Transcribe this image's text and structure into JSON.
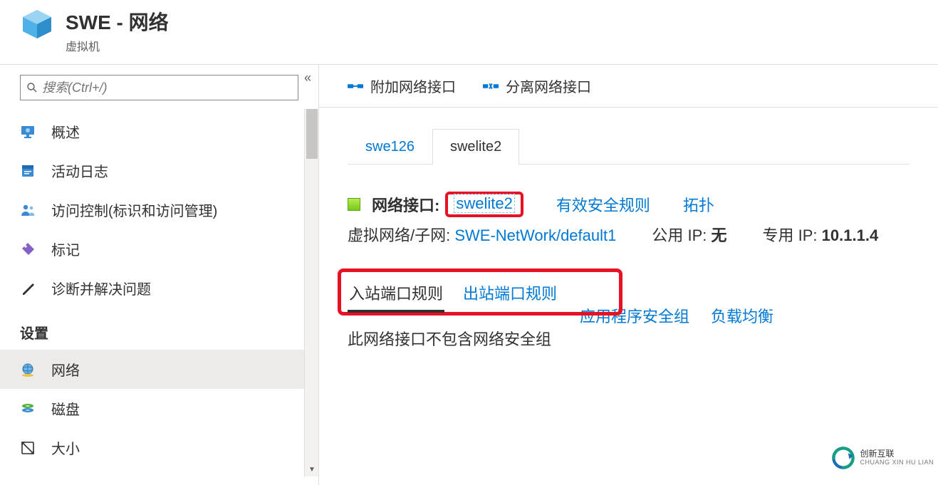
{
  "header": {
    "title": "SWE - 网络",
    "subtitle": "虚拟机"
  },
  "sidebar": {
    "search_placeholder": "搜索(Ctrl+/)",
    "menu_top": [
      {
        "key": "overview",
        "label": "概述"
      },
      {
        "key": "activity-log",
        "label": "活动日志"
      },
      {
        "key": "access-control",
        "label": "访问控制(标识和访问管理)"
      },
      {
        "key": "tags",
        "label": "标记"
      },
      {
        "key": "diagnose",
        "label": "诊断并解决问题"
      }
    ],
    "settings_heading": "设置",
    "menu_settings": [
      {
        "key": "networking",
        "label": "网络",
        "active": true
      },
      {
        "key": "disks",
        "label": "磁盘"
      },
      {
        "key": "size",
        "label": "大小"
      }
    ]
  },
  "toolbar": {
    "attach": "附加网络接口",
    "detach": "分离网络接口"
  },
  "nic_tabs": [
    {
      "id": "swe126",
      "label": "swe126",
      "active": false
    },
    {
      "id": "swelite2",
      "label": "swelite2",
      "active": true
    }
  ],
  "nic_info": {
    "label": "网络接口:",
    "link": "swelite2",
    "rules_link": "有效安全规则",
    "topology_link": "拓扑",
    "vnet_label": "虚拟网络/子网:",
    "vnet_value": "SWE-NetWork/default1",
    "public_ip_label": "公用 IP:",
    "public_ip_value": "无",
    "private_ip_label": "专用 IP:",
    "private_ip_value": "10.1.1.4"
  },
  "rule_tabs": {
    "inbound": "入站端口规则",
    "outbound": "出站端口规则",
    "asg": "应用程序安全组",
    "lb": "负载均衡"
  },
  "empty_message": "此网络接口不包含网络安全组",
  "watermark": {
    "cn": "创新互联",
    "en": "CHUANG XIN HU LIAN"
  }
}
